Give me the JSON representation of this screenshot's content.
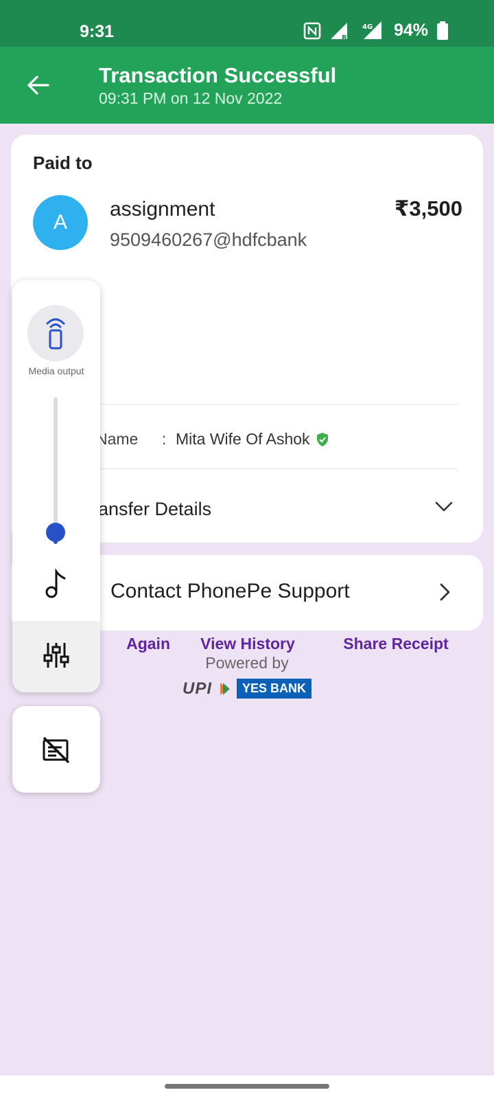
{
  "status_bar": {
    "time": "9:31",
    "battery_percent": "94%",
    "icons": [
      "nfc-icon",
      "signal-r-icon",
      "4g-signal-icon",
      "battery-icon"
    ]
  },
  "header": {
    "title": "Transaction Successful",
    "subtitle": "09:31 PM on 12 Nov 2022"
  },
  "paid_card": {
    "label": "Paid to",
    "avatar_letter": "A",
    "payee_name": "assignment",
    "payee_upi": "9509460267@hdfcbank",
    "amount": "₹3,500",
    "bank_name_label": "Name",
    "bank_colon": ":",
    "bank_name_value": "Mita Wife Of Ashok",
    "transfer_label": "ransfer Details"
  },
  "actions": [
    {
      "label": "Again",
      "icon": "pay-again-icon"
    },
    {
      "label": "View History",
      "icon": "swap-arrows-icon"
    },
    {
      "label": "Share Receipt",
      "icon": "share-icon"
    }
  ],
  "support": {
    "label": "Contact PhonePe Support"
  },
  "footer": {
    "powered_by": "Powered by",
    "upi_logo_text": "UPI",
    "bank_logo_text": "YES BANK"
  },
  "volume_panel": {
    "media_output_label": "Media output",
    "volume_level": 0.08
  },
  "colors": {
    "status_bar": "#1e8a50",
    "header": "#23a35a",
    "accent_purple": "#5f259f",
    "background": "#ede3f5",
    "slider_blue": "#2751c7"
  }
}
